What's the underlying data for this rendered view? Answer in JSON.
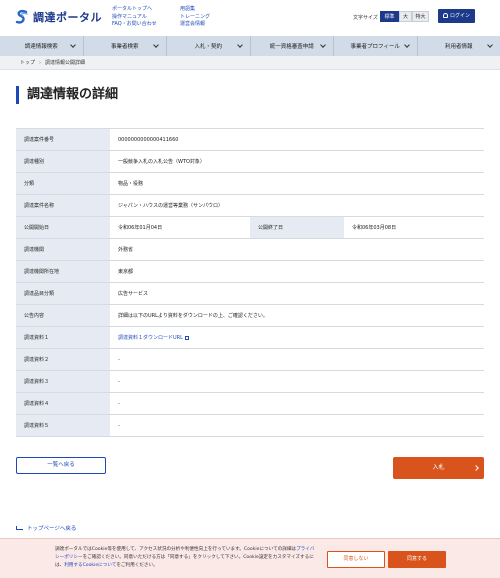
{
  "header": {
    "logo_text": "調達ポータル",
    "links_col1": [
      "ポータルトップへ",
      "操作マニュアル",
      "FAQ・お問い合わせ"
    ],
    "links_col2": [
      "用語集",
      "トレーニング",
      "運営会情報"
    ],
    "font_size_label": "文字サイズ",
    "font_sizes": [
      "標準",
      "大",
      "特大"
    ],
    "login_label": "ログイン"
  },
  "nav": {
    "items": [
      "調達情報検索",
      "事業者検索",
      "入札・契約",
      "統一資格審査申請",
      "事業者プロフィール",
      "利用者情報"
    ]
  },
  "breadcrumb": {
    "items": [
      "トップ",
      "調達情報公開詳細"
    ]
  },
  "page_title": "調達情報の詳細",
  "details": {
    "rows": [
      {
        "label": "調達案件番号",
        "value": "0000000000000411660"
      },
      {
        "label": "調達種別",
        "value": "一般競争入札の入札公告（WTO対象）"
      },
      {
        "label": "分類",
        "value": "物品・役務"
      },
      {
        "label": "調達案件名称",
        "value": "ジャパン・ハウスの運営等業務（サンパウロ）"
      }
    ],
    "period": {
      "start_label": "公開開始日",
      "start_value": "令和06年01月04日",
      "end_label": "公開終了日",
      "end_value": "令和06年03月08日"
    },
    "rows2": [
      {
        "label": "調達機関",
        "value": "外務省"
      },
      {
        "label": "調達機関所在地",
        "value": "東京都"
      },
      {
        "label": "調達品目分類",
        "value": "広告サービス"
      },
      {
        "label": "公告内容",
        "value": "詳細は以下のURLより資料をダウンロードの上、ご確認ください。"
      }
    ],
    "materials": [
      {
        "label": "調達資料１",
        "value": "調達資料１ダウンロードURL"
      },
      {
        "label": "調達資料２",
        "value": "-"
      },
      {
        "label": "調達資料３",
        "value": "-"
      },
      {
        "label": "調達資料４",
        "value": "-"
      },
      {
        "label": "調達資料５",
        "value": "-"
      }
    ]
  },
  "actions": {
    "back_label": "一覧へ戻る",
    "bid_label": "入札"
  },
  "top_link": "トップページへ戻る",
  "cookie": {
    "text_1": "調達ポータルではCookie等を使用して、アクセス状況の分析や利便性向上を行っています。Cookieについての詳細は",
    "privacy_link": "プライバシーポリシー",
    "text_2": "をご確認ください。同意いただける方は「同意する」をクリックして下さい。Cookie設定をカスタマイズするには、",
    "cookie_link": "利用するCookieについて",
    "text_3": "をご利用ください。",
    "deny_label": "同意しない",
    "agree_label": "同意する"
  },
  "colors": {
    "brand": "#1d3a8a",
    "link": "#1d49b8",
    "accent": "#d9541c",
    "label_bg": "#e6ebf3"
  }
}
